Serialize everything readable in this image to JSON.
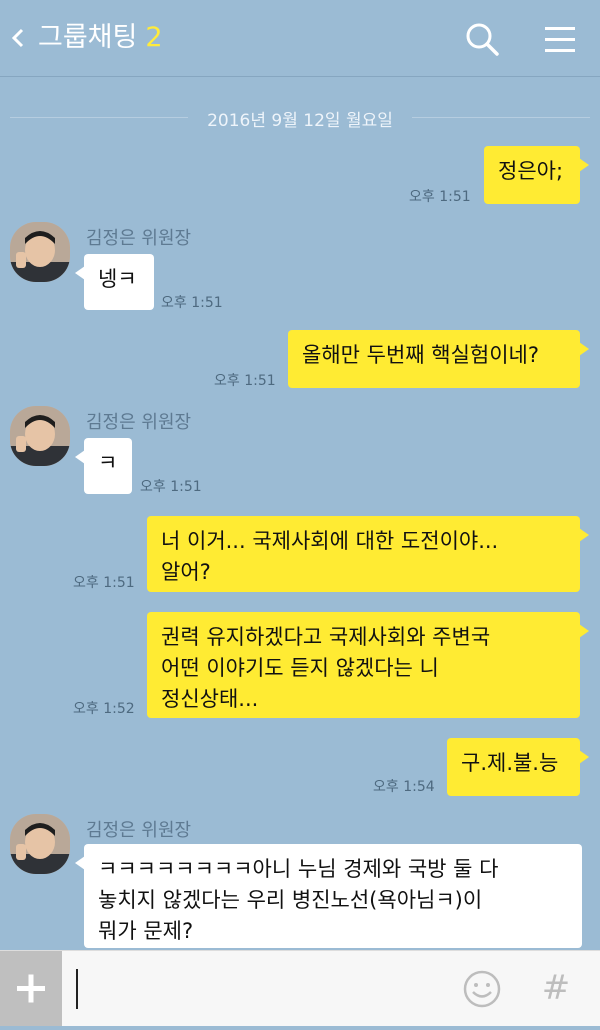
{
  "header": {
    "title": "그룹채팅",
    "member_count": "2"
  },
  "date_divider": "2016년 9월 12일 월요일",
  "contact": {
    "name": "김정은 위원장"
  },
  "messages": [
    {
      "from": "me",
      "text": "정은아;",
      "time": "오후 1:51"
    },
    {
      "from": "them",
      "text": "넹ㅋ",
      "time": "오후 1:51"
    },
    {
      "from": "me",
      "text": "올해만 두번째 핵실험이네?",
      "time": "오후 1:51"
    },
    {
      "from": "them",
      "text": "ㅋ",
      "time": "오후 1:51"
    },
    {
      "from": "me",
      "text": "너 이거... 국제사회에 대한 도전이야...\n알어?",
      "time": "오후 1:51"
    },
    {
      "from": "me",
      "text": "권력 유지하겠다고 국제사회와 주변국\n어떤 이야기도 듣지 않겠다는 니\n정신상태...",
      "time": "오후 1:52"
    },
    {
      "from": "me",
      "text": "구.제.불.능",
      "time": "오후 1:54"
    },
    {
      "from": "them",
      "text": "ㅋㅋㅋㅋㅋㅋㅋㅋ아니 누님 경제와 국방 둘 다\n놓치지 않겠다는 우리 병진노선(욕아님ㅋ)이\n뭐가 문제?",
      "time": ""
    }
  ],
  "input": {
    "value": "",
    "hash_label": "#"
  },
  "colors": {
    "background": "#9bbbd4",
    "my_bubble": "#ffeb33",
    "their_bubble": "#ffffff",
    "accent_count": "#ffeb3b"
  },
  "icons": [
    "back-chevron-icon",
    "search-icon",
    "menu-icon",
    "plus-icon",
    "emoji-icon",
    "hash-icon"
  ]
}
